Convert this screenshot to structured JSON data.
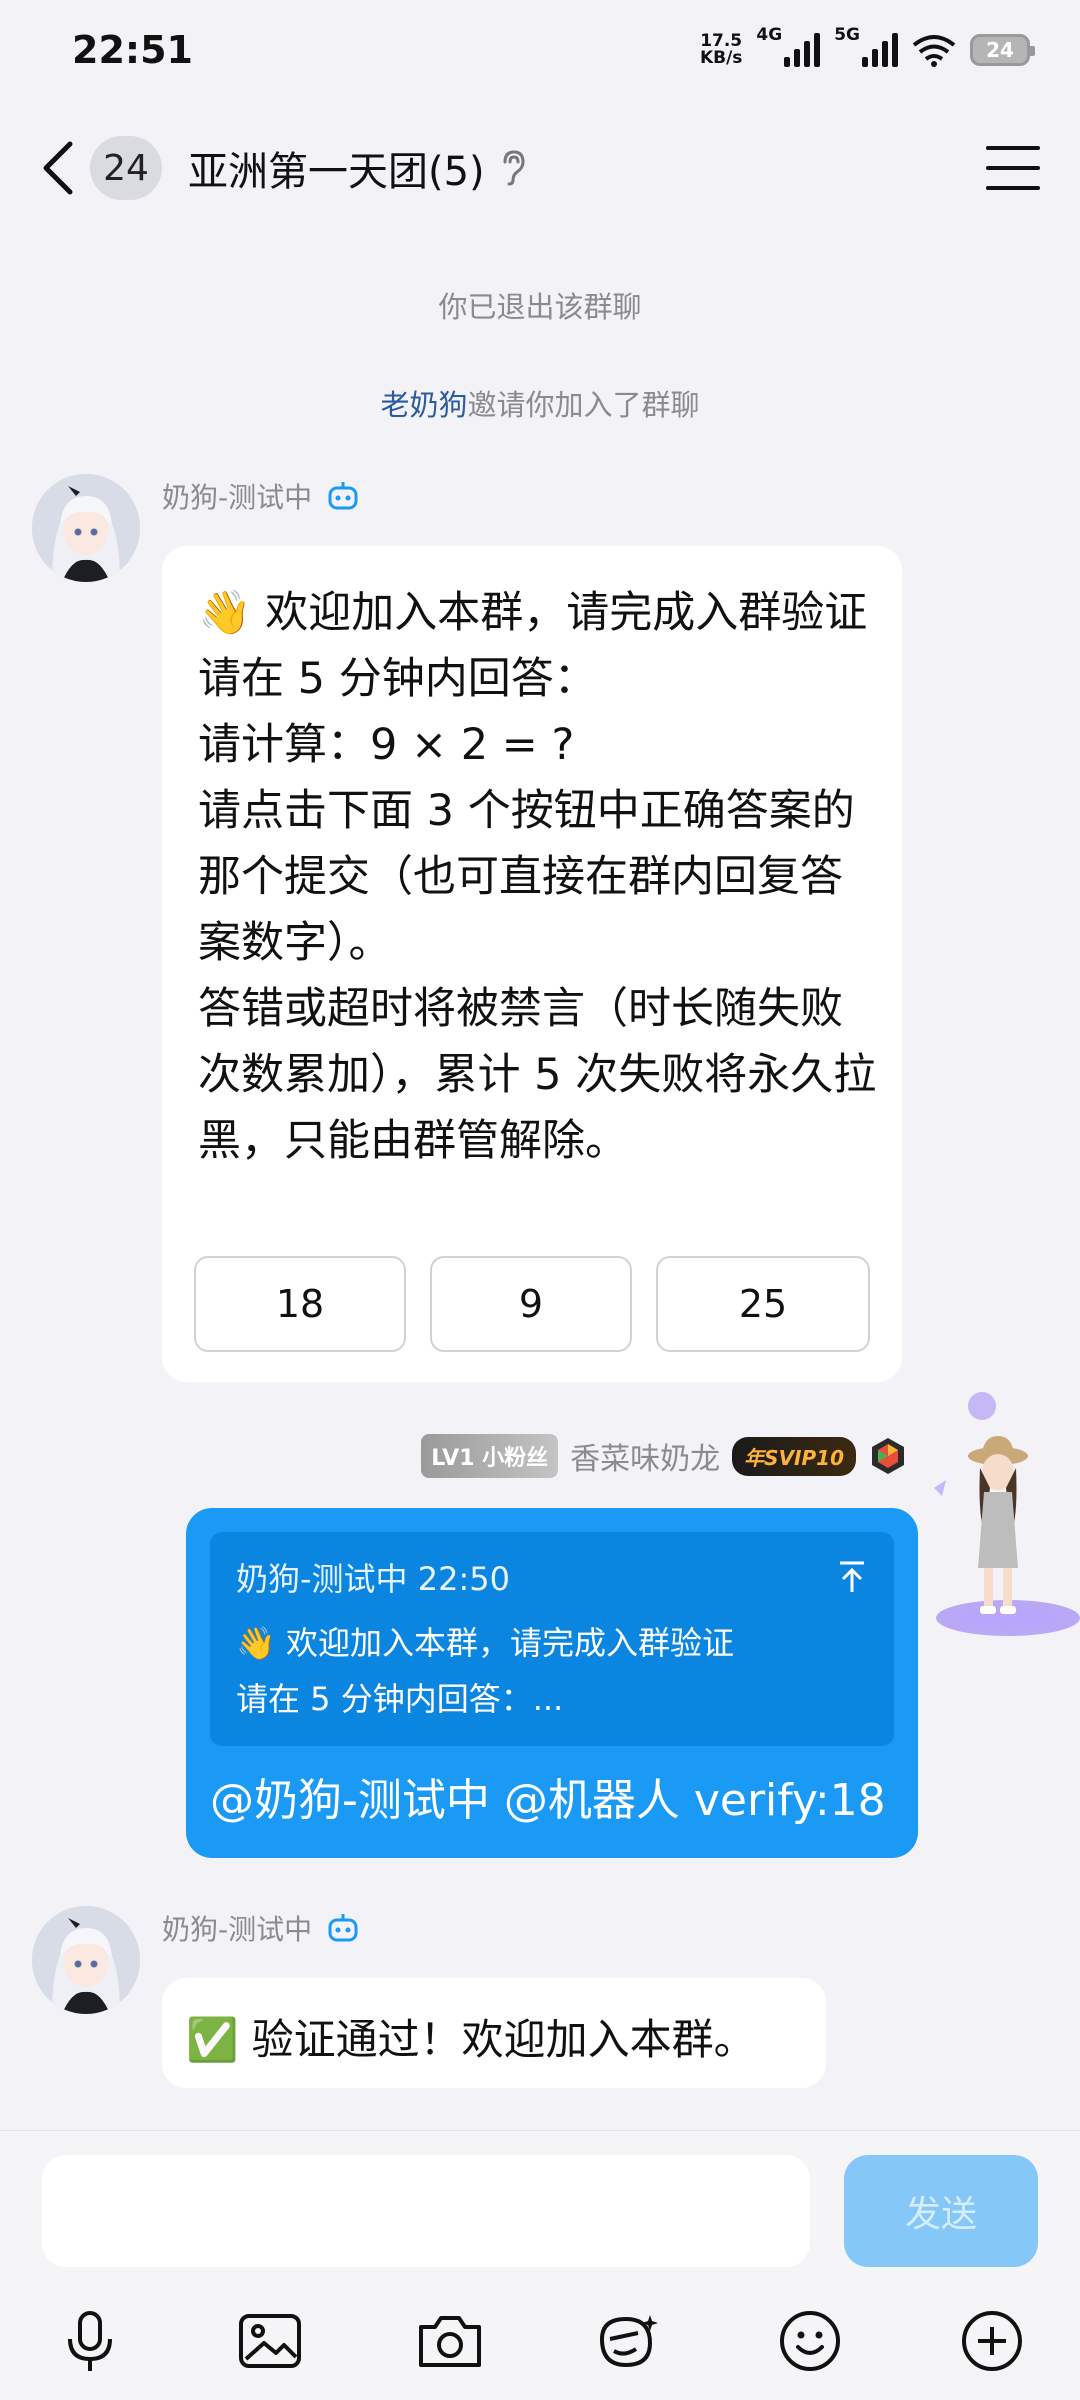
{
  "status_bar": {
    "time": "22:51",
    "net_speed_value": "17.5",
    "net_speed_unit": "KB/s",
    "sim1_label": "4G",
    "sim2_label": "5G",
    "battery": "24"
  },
  "header": {
    "unread_count": "24",
    "title": "亚洲第一天团(5)"
  },
  "system_messages": {
    "left_group": "你已退出该群聊",
    "invite_name": "老奶狗",
    "invite_rest": "邀请你加入了群聊"
  },
  "messages": [
    {
      "sender": "奶狗-测试中",
      "text": "👋 欢迎加入本群，请完成入群验证\n请在 5 分钟内回答：\n请计算：9 × 2 = ?\n请点击下面 3 个按钮中正确答案的那个提交（也可直接在群内回复答案数字）。\n答错或超时将被禁言（时长随失败次数累加），累计 5 次失败将永久拉黑，只能由群管解除。",
      "answers": [
        "18",
        "9",
        "25"
      ]
    },
    {
      "level_badge": "LV1 小粉丝",
      "sender": "香菜味奶龙",
      "svip_badge": "年SVIP10",
      "quote_header": "奶狗-测试中 22:50",
      "quote_line1": "👋 欢迎加入本群，请完成入群验证",
      "quote_line2": "请在 5 分钟内回答：...",
      "text": "@奶狗-测试中 @机器人 verify:18"
    },
    {
      "sender": "奶狗-测试中",
      "text": "✅ 验证通过！欢迎加入本群。"
    }
  ],
  "input": {
    "send_label": "发送",
    "placeholder": ""
  },
  "toolbar": [
    "mic-icon",
    "image-icon",
    "camera-icon",
    "sticker-icon",
    "emoji-icon",
    "plus-icon"
  ],
  "colors": {
    "accent": "#1a9af5",
    "background": "#f2f2f7",
    "send_disabled": "#85c7f7"
  }
}
